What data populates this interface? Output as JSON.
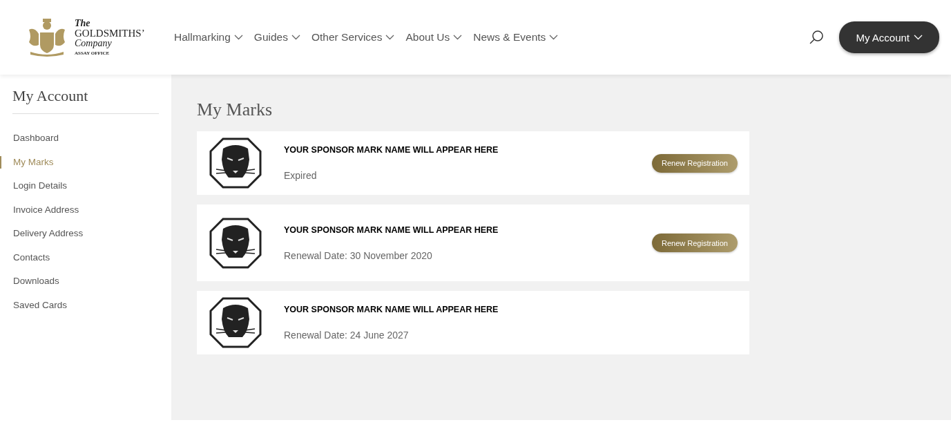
{
  "logo": {
    "line_1": "The",
    "line_2": "GOLDSMITHS’",
    "line_3": "Company",
    "line_4": "ASSAY OFFICE"
  },
  "nav": [
    {
      "label": "Hallmarking"
    },
    {
      "label": "Guides"
    },
    {
      "label": "Other Services"
    },
    {
      "label": "About Us"
    },
    {
      "label": "News & Events"
    }
  ],
  "account_button": "My Account",
  "sidebar": {
    "title": "My Account",
    "items": [
      {
        "label": "Dashboard",
        "selected": false
      },
      {
        "label": "My Marks",
        "selected": true
      },
      {
        "label": "Login Details",
        "selected": false
      },
      {
        "label": "Invoice Address",
        "selected": false
      },
      {
        "label": "Delivery Address",
        "selected": false
      },
      {
        "label": "Contacts",
        "selected": false
      },
      {
        "label": "Downloads",
        "selected": false
      },
      {
        "label": "Saved Cards",
        "selected": false
      }
    ]
  },
  "page_title": "My Marks",
  "marks": [
    {
      "name": "YOUR SPONSOR MARK NAME WILL APPEAR HERE",
      "status": "Expired",
      "button": "Renew Registration"
    },
    {
      "name": "YOUR SPONSOR MARK NAME WILL APPEAR HERE",
      "status": "Renewal Date: 30 November 2020",
      "button": "Renew Registration"
    },
    {
      "name": "YOUR SPONSOR MARK NAME WILL APPEAR HERE",
      "status": "Renewal Date: 24 June 2027"
    }
  ]
}
